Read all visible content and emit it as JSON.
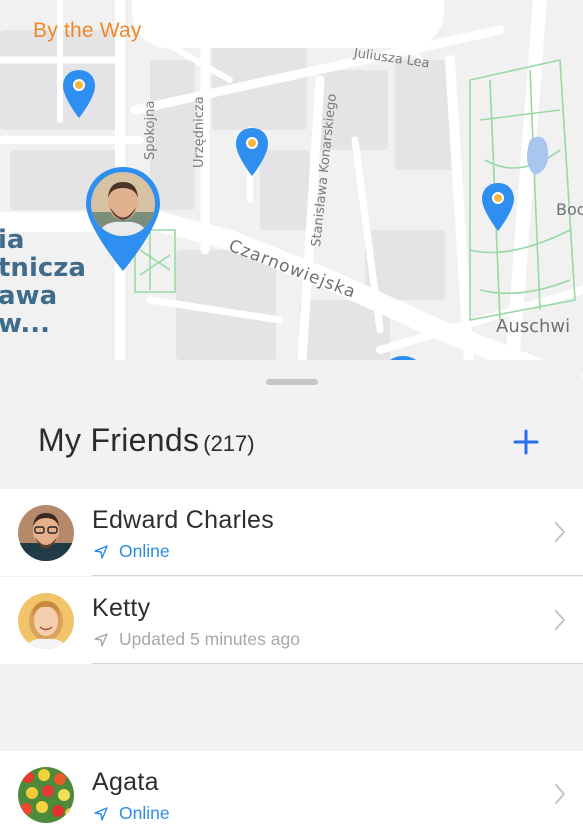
{
  "app": {
    "brand": "By the Way"
  },
  "map": {
    "streets": [
      "Juliusza Lea",
      "Spokojna",
      "Urzędnicza",
      "Stanisława Konarskiego",
      "Czarnowiejska",
      "Bod",
      "Auschwi"
    ],
    "district_lines": [
      "ia",
      "tnicza",
      "awa",
      "w..."
    ],
    "colors": {
      "pin": "#2f8ff0",
      "pin_dot": "#f6b73c",
      "park_line": "#98d9a4",
      "road": "#ffffff",
      "block": "#e4e4e6"
    }
  },
  "friends_panel": {
    "title": "My Friends",
    "count": "(217)",
    "add_icon": "plus-icon",
    "friends": [
      {
        "name": "Edward Charles",
        "status": "Online",
        "status_type": "online",
        "status_icon": "navigation-arrow-icon"
      },
      {
        "name": "Ketty",
        "status": "Updated 5 minutes ago",
        "status_type": "updated",
        "status_icon": "navigation-arrow-icon"
      },
      {
        "name": "Agata",
        "status": "Online",
        "status_type": "online",
        "status_icon": "navigation-arrow-icon"
      }
    ]
  },
  "colors": {
    "accent": "#2b6ff0",
    "online": "#2b8ce8",
    "muted": "#a8a8ab",
    "brand": "#f0882b"
  }
}
